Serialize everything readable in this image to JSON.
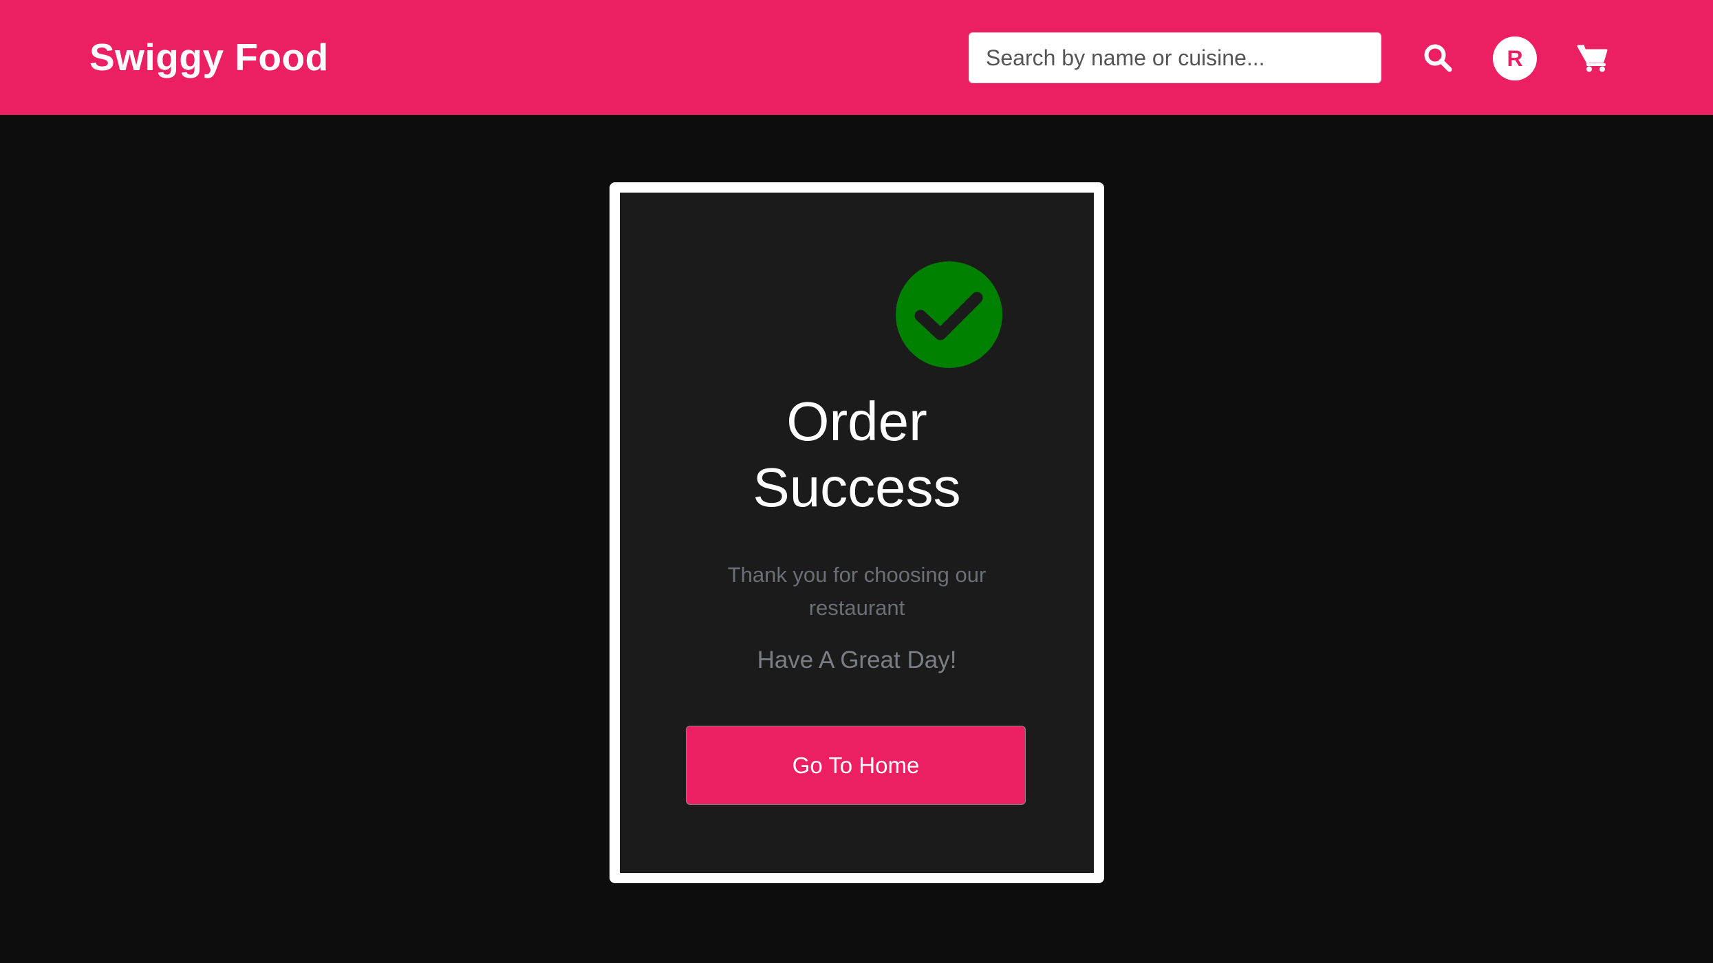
{
  "header": {
    "brand": "Swiggy Food",
    "search_placeholder": "Search by name or cuisine...",
    "search_value": "",
    "search_icon": "search-icon",
    "avatar_initial": "R",
    "cart_icon": "cart-icon",
    "background_color": "#ec1f62"
  },
  "order_card": {
    "status_icon": "check-circle-icon",
    "status_color": "#008000",
    "title_line1": "Order",
    "title_line2": "Success",
    "message": "Thank you for choosing our restaurant",
    "greeting": "Have A Great Day!",
    "home_button_label": "Go To Home"
  },
  "colors": {
    "accent": "#ec1f62",
    "page_background": "#0d0d0d",
    "card_background": "#1b1b1b",
    "card_border": "#ffffff"
  }
}
